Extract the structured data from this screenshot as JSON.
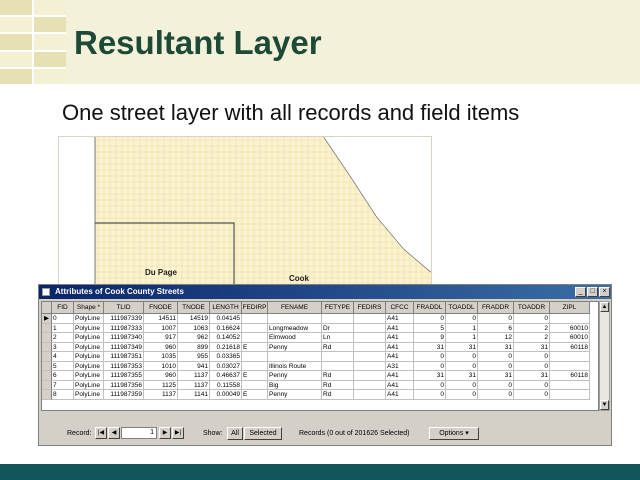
{
  "slide": {
    "title": "Resultant Layer",
    "subtitle": "One street layer with all records and field items"
  },
  "map": {
    "labels": [
      "Du Page",
      "Cook"
    ],
    "fill_color": "#fbf2d2",
    "border_color": "#555555"
  },
  "window": {
    "title": "Attributes of Cook County Streets",
    "buttons": {
      "minimize": "_",
      "maximize": "□",
      "close": "×"
    },
    "columns": [
      "FID",
      "Shape *",
      "TLID",
      "FNODE",
      "TNODE",
      "LENGTH",
      "FEDIRP",
      "FENAME",
      "FETYPE",
      "FEDIRS",
      "CFCC",
      "FRADDL",
      "TOADDL",
      "FRADDR",
      "TOADDR",
      "ZIPL"
    ],
    "rows": [
      [
        "0",
        "PolyLine",
        "111987339",
        "14511",
        "14519",
        "0.04145",
        "",
        "",
        "",
        "",
        "A41",
        "0",
        "0",
        "0",
        "0",
        ""
      ],
      [
        "1",
        "PolyLine",
        "111987333",
        "1007",
        "1063",
        "0.16624",
        "",
        "Longmeadow",
        "Dr",
        "",
        "A41",
        "5",
        "1",
        "6",
        "2",
        "60010"
      ],
      [
        "2",
        "PolyLine",
        "111987340",
        "917",
        "962",
        "0.14052",
        "",
        "Elmwood",
        "Ln",
        "",
        "A41",
        "9",
        "1",
        "12",
        "2",
        "60010"
      ],
      [
        "3",
        "PolyLine",
        "111987349",
        "960",
        "899",
        "0.21618",
        "E",
        "Penny",
        "Rd",
        "",
        "A41",
        "31",
        "31",
        "31",
        "31",
        "60118"
      ],
      [
        "4",
        "PolyLine",
        "111987351",
        "1035",
        "955",
        "0.03365",
        "",
        "",
        "",
        "",
        "A41",
        "0",
        "0",
        "0",
        "0",
        ""
      ],
      [
        "5",
        "PolyLine",
        "111987353",
        "1010",
        "941",
        "0.03027",
        "",
        "Illinois Route",
        "",
        "",
        "A31",
        "0",
        "0",
        "0",
        "0",
        ""
      ],
      [
        "6",
        "PolyLine",
        "111987355",
        "960",
        "1137",
        "0.46637",
        "E",
        "Penny",
        "Rd",
        "",
        "A41",
        "31",
        "31",
        "31",
        "31",
        "60118"
      ],
      [
        "7",
        "PolyLine",
        "111987356",
        "1125",
        "1137",
        "0.11558",
        "",
        "Big",
        "Rd",
        "",
        "A41",
        "0",
        "0",
        "0",
        "0",
        ""
      ],
      [
        "8",
        "PolyLine",
        "111987359",
        "1137",
        "1141",
        "0.00049",
        "E",
        "Penny",
        "Rd",
        "",
        "A41",
        "0",
        "0",
        "0",
        "0",
        ""
      ]
    ],
    "current_row_marker": "▶",
    "status": {
      "record_label": "Record:",
      "record_value": "1",
      "nav": {
        "first": "|◀",
        "prev": "◀",
        "next": "▶",
        "last": "▶|"
      },
      "show_label": "Show:",
      "all_button": "All",
      "selected_button": "Selected",
      "records_text": "Records (0 out of 201626 Selected)",
      "options_button": "Options ▾"
    }
  },
  "colors": {
    "title_green": "#1d4a37",
    "footer_teal": "#0f5559",
    "titlebar_blue": "#0a246a"
  }
}
